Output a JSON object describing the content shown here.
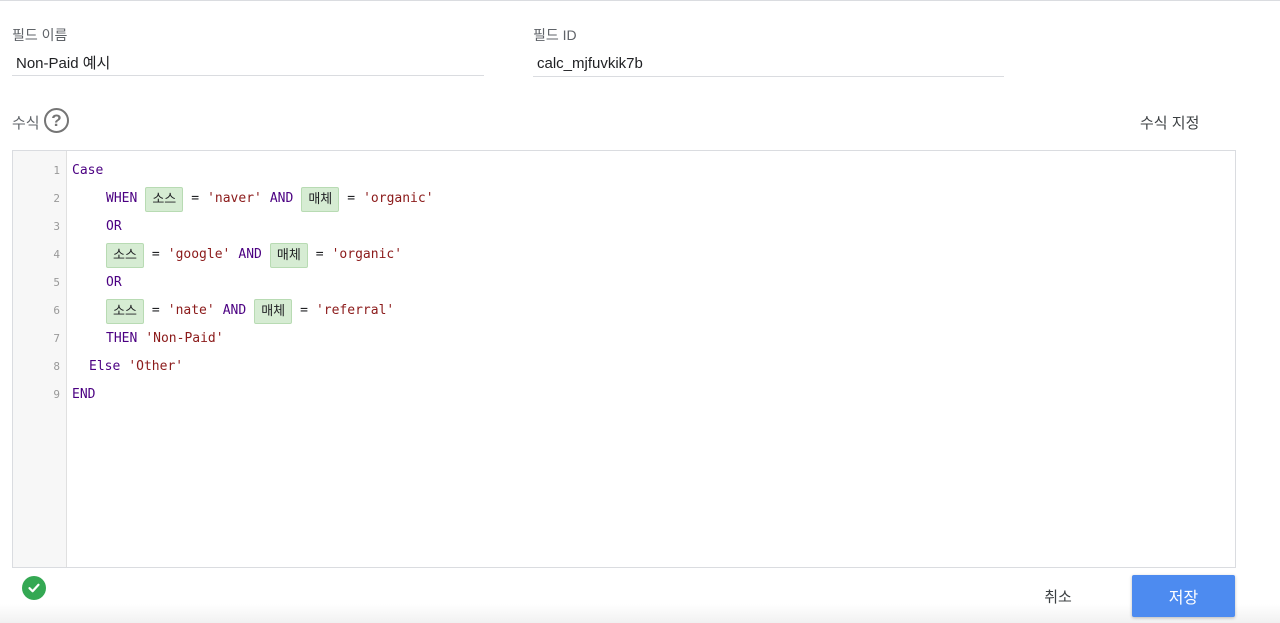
{
  "form": {
    "field_name_label": "필드 이름",
    "field_name_value": "Non-Paid 예시",
    "field_id_label": "필드 ID",
    "field_id_value": "calc_mjfuvkik7b",
    "formula_label": "수식",
    "help_icon": "question-circle-icon",
    "format_formula_label": "수식 지정"
  },
  "editor": {
    "line_numbers": [
      "1",
      "2",
      "3",
      "4",
      "5",
      "6",
      "7",
      "8",
      "9"
    ],
    "lines": [
      [
        {
          "t": "kw",
          "v": "Case"
        }
      ],
      [
        {
          "t": "kw",
          "v": "WHEN"
        },
        {
          "t": "chip",
          "v": "소스"
        },
        {
          "t": "op",
          "v": "="
        },
        {
          "t": "str",
          "v": "'naver'"
        },
        {
          "t": "kw",
          "v": "AND"
        },
        {
          "t": "chip",
          "v": "매체"
        },
        {
          "t": "op",
          "v": "="
        },
        {
          "t": "str",
          "v": "'organic'"
        }
      ],
      [
        {
          "t": "kw",
          "v": "OR"
        }
      ],
      [
        {
          "t": "chip",
          "v": "소스"
        },
        {
          "t": "op",
          "v": "="
        },
        {
          "t": "str",
          "v": "'google'"
        },
        {
          "t": "kw",
          "v": "AND"
        },
        {
          "t": "chip",
          "v": "매체"
        },
        {
          "t": "op",
          "v": "="
        },
        {
          "t": "str",
          "v": "'organic'"
        }
      ],
      [
        {
          "t": "kw",
          "v": "OR"
        }
      ],
      [
        {
          "t": "chip",
          "v": "소스"
        },
        {
          "t": "op",
          "v": "="
        },
        {
          "t": "str",
          "v": "'nate'"
        },
        {
          "t": "kw",
          "v": "AND"
        },
        {
          "t": "chip",
          "v": "매체"
        },
        {
          "t": "op",
          "v": "="
        },
        {
          "t": "str",
          "v": "'referral'"
        }
      ],
      [
        {
          "t": "kw",
          "v": "THEN"
        },
        {
          "t": "str",
          "v": "'Non-Paid'"
        }
      ],
      [
        {
          "t": "kw",
          "v": "Else"
        },
        {
          "t": "str",
          "v": "'Other'"
        }
      ],
      [
        {
          "t": "kw",
          "v": "END"
        }
      ]
    ]
  },
  "footer": {
    "status_icon": "check-circle-icon",
    "status_color": "#34a853",
    "cancel_label": "취소",
    "save_label": "저장",
    "save_color": "#4d8bf0"
  }
}
